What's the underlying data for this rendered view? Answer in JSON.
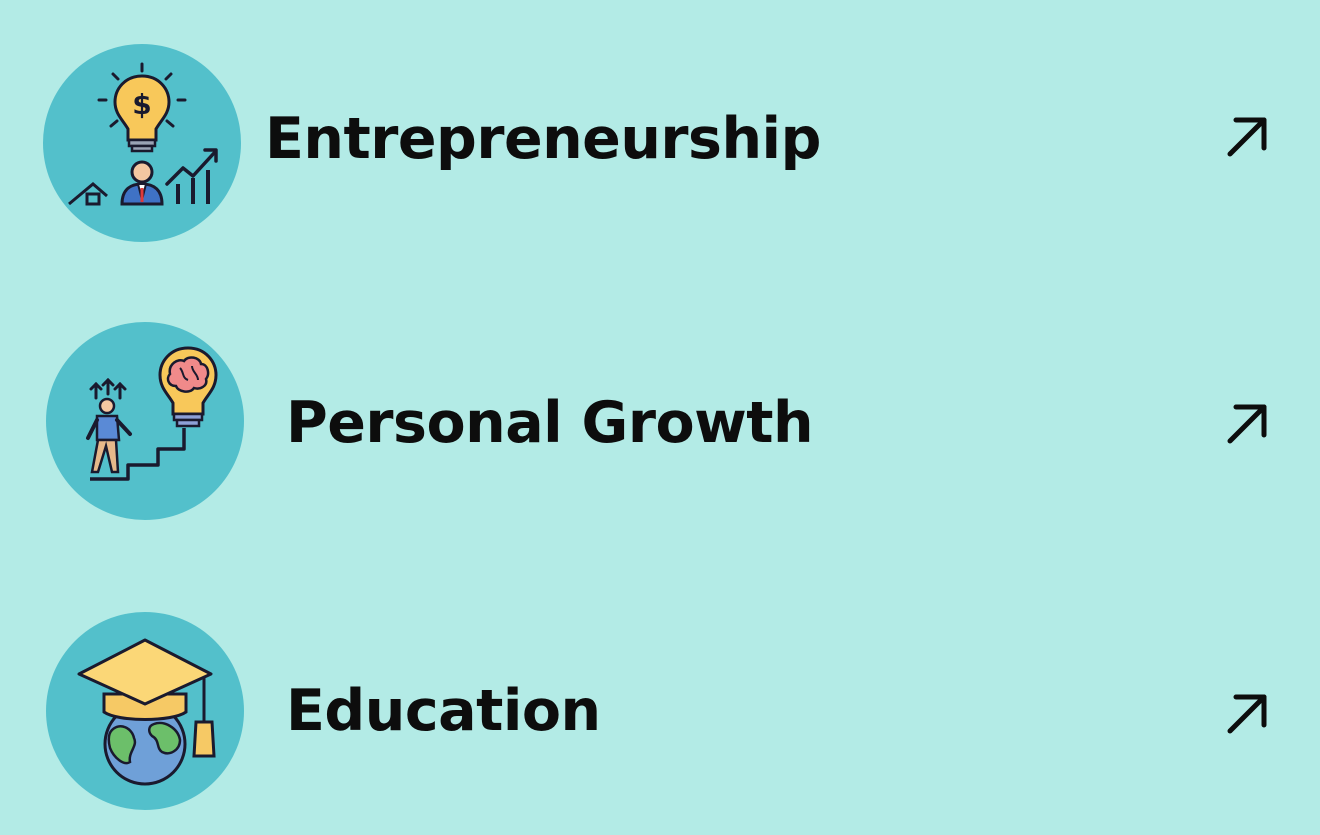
{
  "topics": [
    {
      "label": "Entrepreneurship",
      "icon": "lightbulb-dollar-growth-icon",
      "link_icon": "arrow-up-right-icon"
    },
    {
      "label": "Personal Growth",
      "icon": "brain-lightbulb-stairs-icon",
      "link_icon": "arrow-up-right-icon"
    },
    {
      "label": "Education",
      "icon": "graduation-cap-globe-icon",
      "link_icon": "arrow-up-right-icon"
    }
  ],
  "colors": {
    "background": "#b3ebe6",
    "icon_circle": "#53c0cb",
    "text": "#0d0d0d"
  }
}
